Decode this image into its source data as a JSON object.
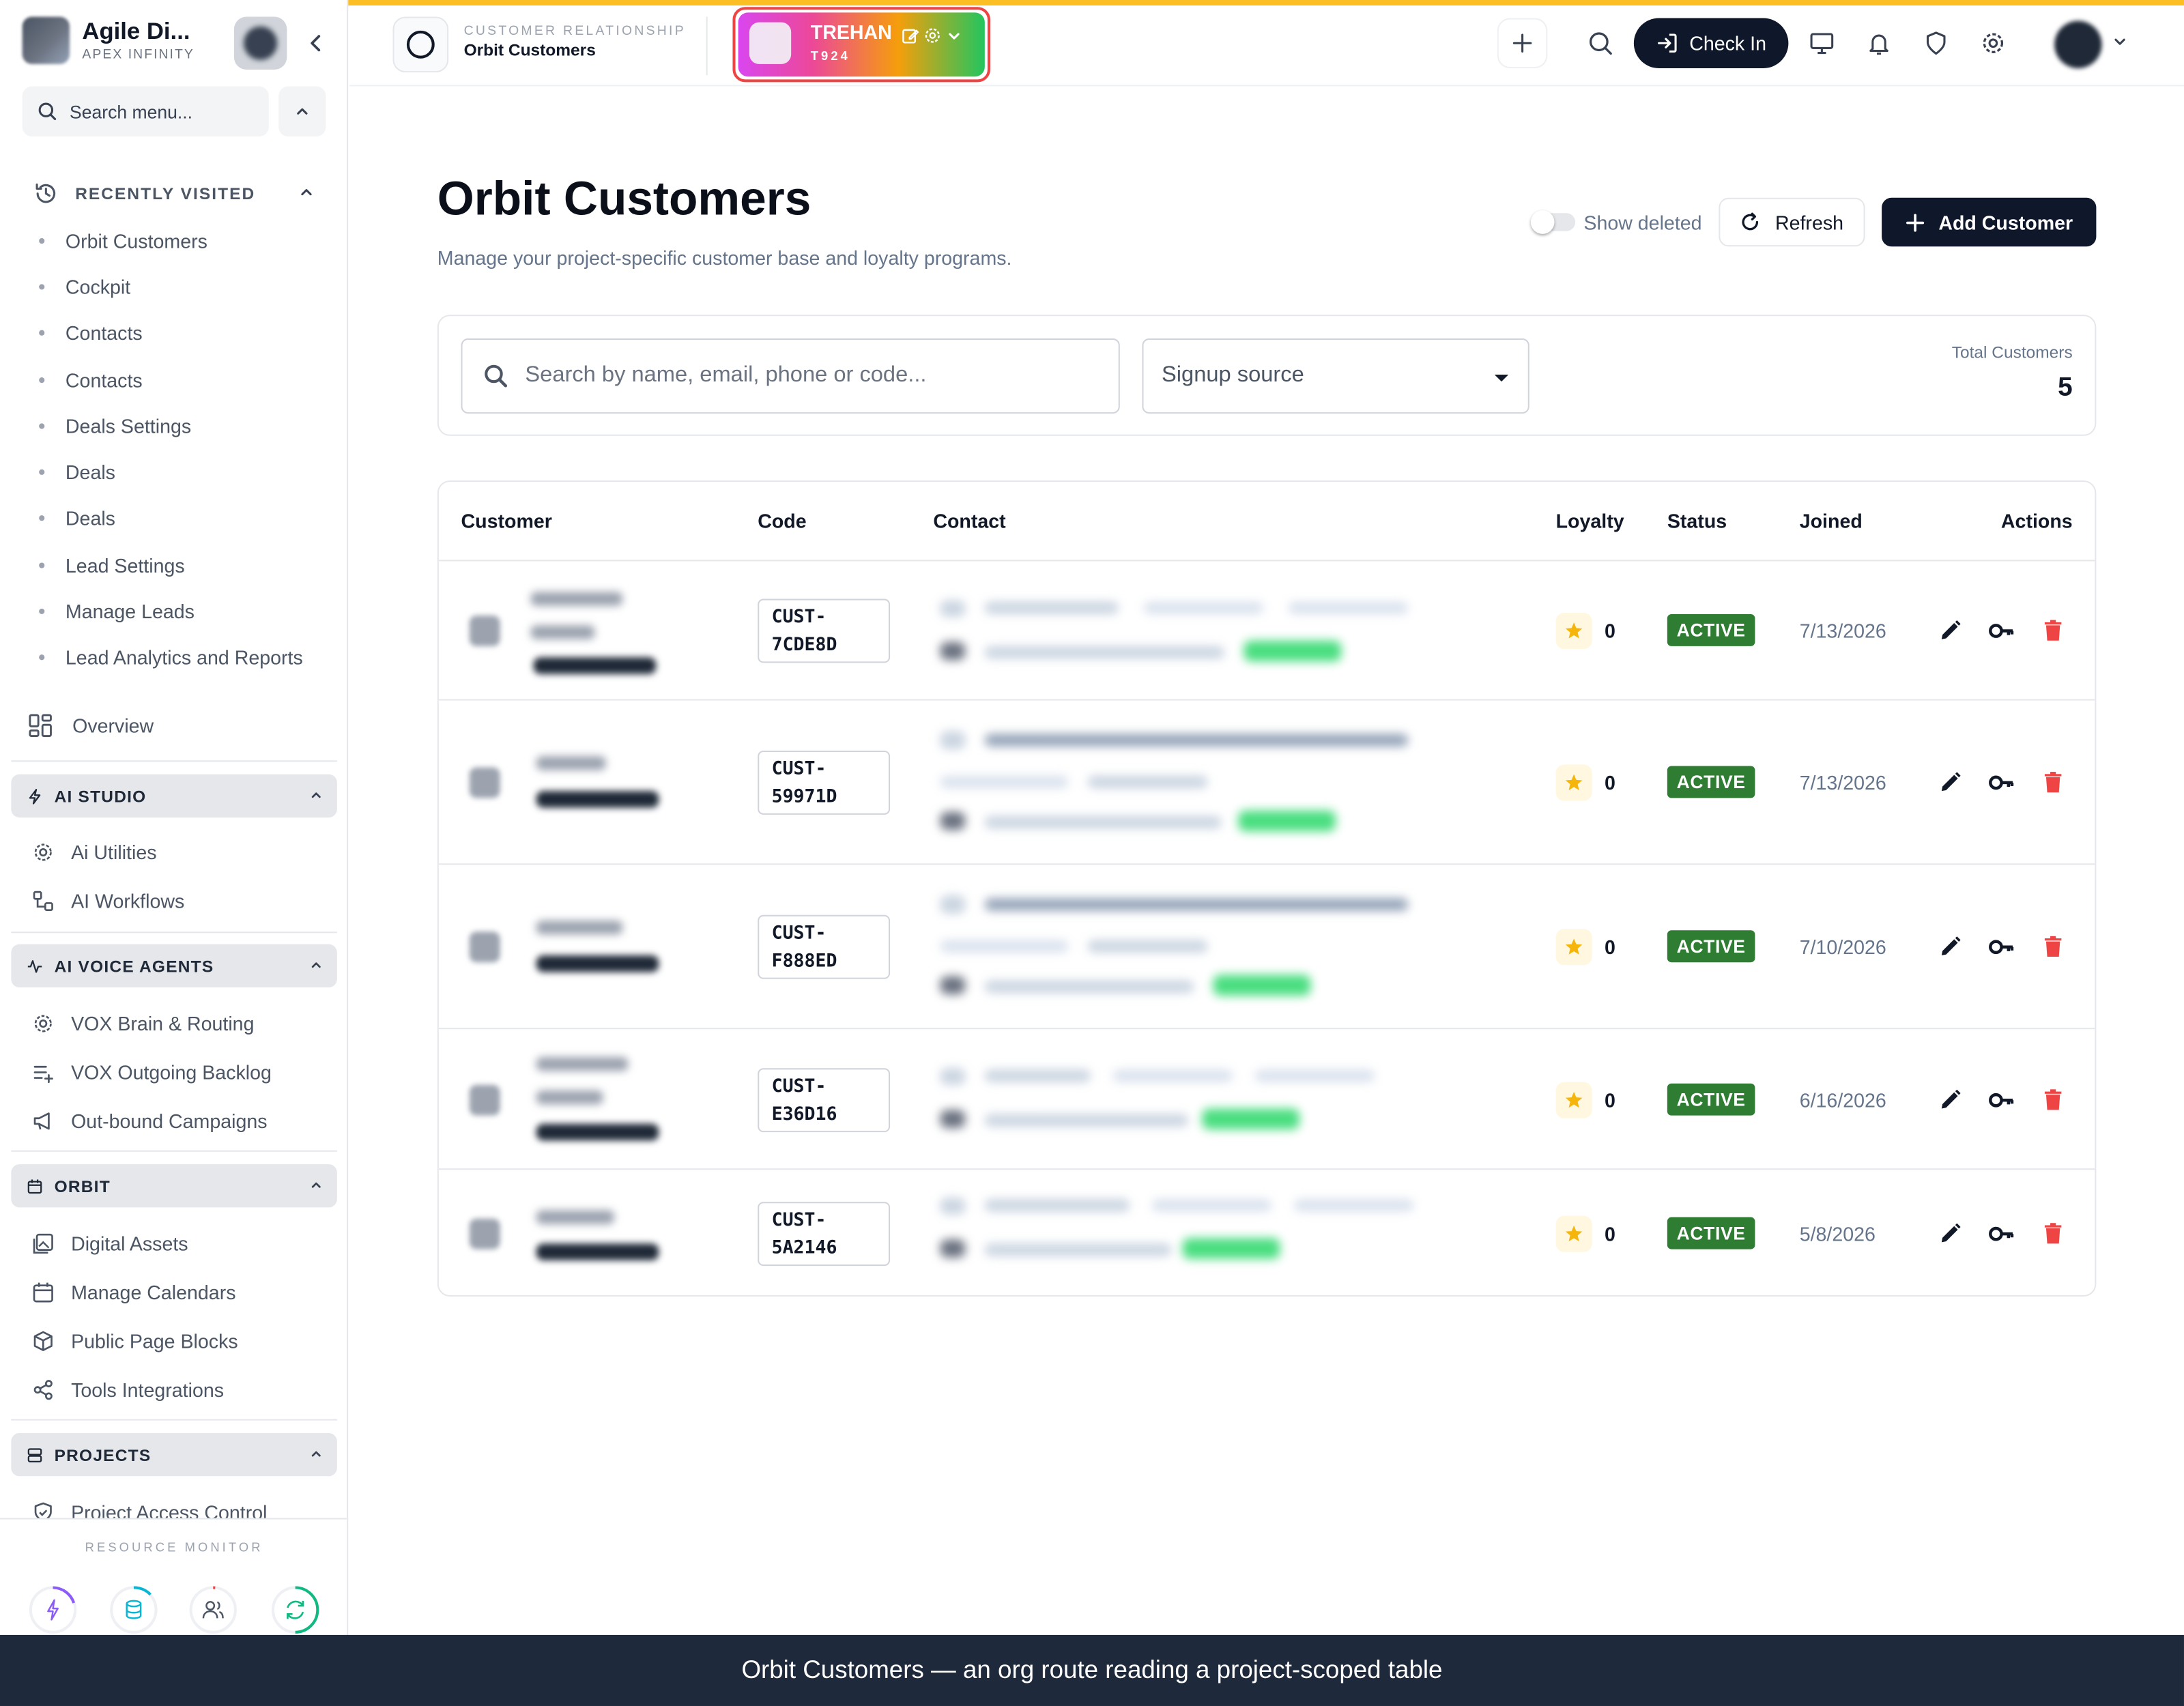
{
  "colors": {
    "accent": "#0f172a",
    "top_strip": "#fbbf24",
    "active_badge": "#2e7d32",
    "delete_icon": "#ef4444",
    "star": "#f5b50a"
  },
  "sidebar": {
    "brand_name": "Agile Di...",
    "brand_sub": "APEX INFINITY",
    "search_placeholder": "Search menu...",
    "recently_visited_label": "RECENTLY VISITED",
    "recent_items": [
      "Orbit Customers",
      "Cockpit",
      "Contacts",
      "Contacts",
      "Deals Settings",
      "Deals",
      "Deals",
      "Lead Settings",
      "Manage Leads",
      "Lead Analytics and Reports"
    ],
    "overview_label": "Overview",
    "sections": [
      {
        "label": "AI STUDIO",
        "icon": "bolt-icon",
        "items": [
          {
            "label": "Ai Utilities",
            "icon": "gear-cog-icon"
          },
          {
            "label": "AI Workflows",
            "icon": "workflow-icon"
          }
        ]
      },
      {
        "label": "AI VOICE AGENTS",
        "icon": "activity-icon",
        "items": [
          {
            "label": "VOX Brain & Routing",
            "icon": "gear-cog-icon"
          },
          {
            "label": "VOX Outgoing Backlog",
            "icon": "list-plus-icon"
          },
          {
            "label": "Out-bound Campaigns",
            "icon": "megaphone-icon"
          }
        ]
      },
      {
        "label": "ORBIT",
        "icon": "calendar-icon",
        "items": [
          {
            "label": "Digital Assets",
            "icon": "image-icon"
          },
          {
            "label": "Manage Calendars",
            "icon": "calendar-icon"
          },
          {
            "label": "Public Page Blocks",
            "icon": "cube-icon"
          },
          {
            "label": "Tools Integrations",
            "icon": "share-icon"
          }
        ]
      },
      {
        "label": "PROJECTS",
        "icon": "server-icon",
        "items": [
          {
            "label": "Project Access Control",
            "icon": "shield-icon"
          }
        ]
      }
    ],
    "resource_monitor_label": "RESOURCE MONITOR",
    "resource_icons": [
      "bolt-icon",
      "database-icon",
      "users-icon",
      "refresh-icon"
    ]
  },
  "header": {
    "module_label": "CUSTOMER RELATIONSHIP",
    "module_title": "Orbit Customers",
    "project_name": "TREHAN",
    "project_code": "T924",
    "checkin_label": "Check In"
  },
  "main": {
    "title": "Orbit Customers",
    "subtitle": "Manage your project-specific customer base and loyalty programs.",
    "show_deleted_label": "Show deleted",
    "show_deleted": false,
    "refresh_label": "Refresh",
    "add_label": "Add Customer",
    "search_placeholder": "Search by name, email, phone or code...",
    "signup_source_placeholder": "Signup source",
    "total_label": "Total Customers",
    "total_value": "5",
    "columns": [
      "Customer",
      "Code",
      "Contact",
      "Loyalty",
      "Status",
      "Joined",
      "Actions"
    ],
    "rows": [
      {
        "code": "CUST-\n7CDE8D",
        "loyalty": "0",
        "status": "ACTIVE",
        "joined": "7/13/2026"
      },
      {
        "code": "CUST-\n59971D",
        "loyalty": "0",
        "status": "ACTIVE",
        "joined": "7/13/2026"
      },
      {
        "code": "CUST-\nF888ED",
        "loyalty": "0",
        "status": "ACTIVE",
        "joined": "7/10/2026"
      },
      {
        "code": "CUST-\nE36D16",
        "loyalty": "0",
        "status": "ACTIVE",
        "joined": "6/16/2026"
      },
      {
        "code": "CUST-\n5A2146",
        "loyalty": "0",
        "status": "ACTIVE",
        "joined": "5/8/2026"
      }
    ]
  },
  "footer": {
    "caption": "Orbit Customers — an org route reading a project-scoped table"
  }
}
